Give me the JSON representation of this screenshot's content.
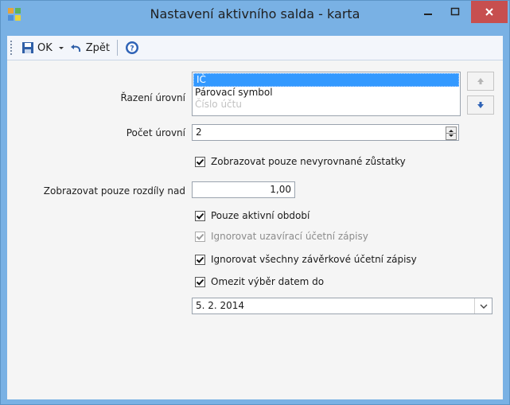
{
  "window": {
    "title": "Nastavení aktivního salda - karta"
  },
  "toolbar": {
    "ok_label": "OK",
    "back_label": "Zpět"
  },
  "form": {
    "sort_levels_label": "Řazení úrovní",
    "sort_levels_items": [
      "IČ",
      "Párovací symbol",
      "Číslo účtu"
    ],
    "level_count_label": "Počet úrovní",
    "level_count_value": "2",
    "only_unbalanced_label": "Zobrazovat pouze nevyrovnané zůstatky",
    "only_unbalanced_checked": true,
    "diff_above_label": "Zobrazovat pouze rozdíly nad",
    "diff_above_value": "1,00",
    "only_active_period_label": "Pouze aktivní období",
    "only_active_period_checked": true,
    "ignore_closing_label": "Ignorovat uzavírací účetní zápisy",
    "ignore_closing_checked": true,
    "ignore_closing_disabled": true,
    "ignore_all_final_label": "Ignorovat všechny závěrkové účetní zápisy",
    "ignore_all_final_checked": true,
    "limit_by_date_label": "Omezit výběr datem do",
    "limit_by_date_checked": true,
    "date_value": "5. 2. 2014"
  },
  "colors": {
    "window_frame": "#79b1e4",
    "close_button": "#c74f4f",
    "selection": "#3399ff"
  }
}
